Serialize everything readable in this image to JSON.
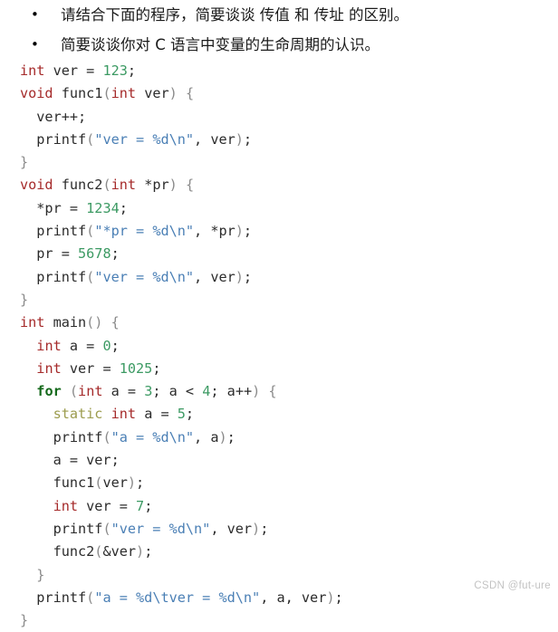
{
  "questions": [
    {
      "bullet": "•",
      "text": "请结合下面的程序，简要谈谈 传值 和 传址 的区别。"
    },
    {
      "bullet": "•",
      "text": "简要谈谈你对 C 语言中变量的生命周期的认识。"
    }
  ],
  "code": {
    "language": "c",
    "lines": [
      [
        {
          "t": "int",
          "c": "kw"
        },
        {
          "t": " ver ",
          "c": "plain"
        },
        {
          "t": "= ",
          "c": "plain"
        },
        {
          "t": "123",
          "c": "num"
        },
        {
          "t": ";",
          "c": "plain"
        }
      ],
      [
        {
          "t": "void",
          "c": "kw"
        },
        {
          "t": " func1",
          "c": "plain"
        },
        {
          "t": "(",
          "c": "punc"
        },
        {
          "t": "int",
          "c": "kw"
        },
        {
          "t": " ver",
          "c": "plain"
        },
        {
          "t": ")",
          "c": "punc"
        },
        {
          "t": " ",
          "c": "plain"
        },
        {
          "t": "{",
          "c": "punc"
        }
      ],
      [
        {
          "t": "  ver++;",
          "c": "plain"
        }
      ],
      [
        {
          "t": "  printf",
          "c": "plain"
        },
        {
          "t": "(",
          "c": "punc"
        },
        {
          "t": "\"ver = %d\\n\"",
          "c": "str"
        },
        {
          "t": ", ver",
          "c": "plain"
        },
        {
          "t": ")",
          "c": "punc"
        },
        {
          "t": ";",
          "c": "plain"
        }
      ],
      [
        {
          "t": "}",
          "c": "punc"
        }
      ],
      [
        {
          "t": "void",
          "c": "kw"
        },
        {
          "t": " func2",
          "c": "plain"
        },
        {
          "t": "(",
          "c": "punc"
        },
        {
          "t": "int",
          "c": "kw"
        },
        {
          "t": " *pr",
          "c": "plain"
        },
        {
          "t": ")",
          "c": "punc"
        },
        {
          "t": " ",
          "c": "plain"
        },
        {
          "t": "{",
          "c": "punc"
        }
      ],
      [
        {
          "t": "  *pr = ",
          "c": "plain"
        },
        {
          "t": "1234",
          "c": "num"
        },
        {
          "t": ";",
          "c": "plain"
        }
      ],
      [
        {
          "t": "  printf",
          "c": "plain"
        },
        {
          "t": "(",
          "c": "punc"
        },
        {
          "t": "\"*pr = %d\\n\"",
          "c": "str"
        },
        {
          "t": ", *pr",
          "c": "plain"
        },
        {
          "t": ")",
          "c": "punc"
        },
        {
          "t": ";",
          "c": "plain"
        }
      ],
      [
        {
          "t": "  pr = ",
          "c": "plain"
        },
        {
          "t": "5678",
          "c": "num"
        },
        {
          "t": ";",
          "c": "plain"
        }
      ],
      [
        {
          "t": "  printf",
          "c": "plain"
        },
        {
          "t": "(",
          "c": "punc"
        },
        {
          "t": "\"ver = %d\\n\"",
          "c": "str"
        },
        {
          "t": ", ver",
          "c": "plain"
        },
        {
          "t": ")",
          "c": "punc"
        },
        {
          "t": ";",
          "c": "plain"
        }
      ],
      [
        {
          "t": "}",
          "c": "punc"
        }
      ],
      [
        {
          "t": "int",
          "c": "kw"
        },
        {
          "t": " main",
          "c": "plain"
        },
        {
          "t": "()",
          "c": "punc"
        },
        {
          "t": " ",
          "c": "plain"
        },
        {
          "t": "{",
          "c": "punc"
        }
      ],
      [
        {
          "t": "  ",
          "c": "plain"
        },
        {
          "t": "int",
          "c": "kw"
        },
        {
          "t": " a = ",
          "c": "plain"
        },
        {
          "t": "0",
          "c": "num"
        },
        {
          "t": ";",
          "c": "plain"
        }
      ],
      [
        {
          "t": "  ",
          "c": "plain"
        },
        {
          "t": "int",
          "c": "kw"
        },
        {
          "t": " ver = ",
          "c": "plain"
        },
        {
          "t": "1025",
          "c": "num"
        },
        {
          "t": ";",
          "c": "plain"
        }
      ],
      [
        {
          "t": "  ",
          "c": "plain"
        },
        {
          "t": "for",
          "c": "kw-ctrl"
        },
        {
          "t": " ",
          "c": "plain"
        },
        {
          "t": "(",
          "c": "punc"
        },
        {
          "t": "int",
          "c": "kw"
        },
        {
          "t": " a = ",
          "c": "plain"
        },
        {
          "t": "3",
          "c": "num"
        },
        {
          "t": "; a < ",
          "c": "plain"
        },
        {
          "t": "4",
          "c": "num"
        },
        {
          "t": "; a++",
          "c": "plain"
        },
        {
          "t": ")",
          "c": "punc"
        },
        {
          "t": " ",
          "c": "plain"
        },
        {
          "t": "{",
          "c": "punc"
        }
      ],
      [
        {
          "t": "    ",
          "c": "plain"
        },
        {
          "t": "static",
          "c": "kw-stor"
        },
        {
          "t": " ",
          "c": "plain"
        },
        {
          "t": "int",
          "c": "kw"
        },
        {
          "t": " a = ",
          "c": "plain"
        },
        {
          "t": "5",
          "c": "num"
        },
        {
          "t": ";",
          "c": "plain"
        }
      ],
      [
        {
          "t": "    printf",
          "c": "plain"
        },
        {
          "t": "(",
          "c": "punc"
        },
        {
          "t": "\"a = %d\\n\"",
          "c": "str"
        },
        {
          "t": ", a",
          "c": "plain"
        },
        {
          "t": ")",
          "c": "punc"
        },
        {
          "t": ";",
          "c": "plain"
        }
      ],
      [
        {
          "t": "    a = ver;",
          "c": "plain"
        }
      ],
      [
        {
          "t": "    func1",
          "c": "plain"
        },
        {
          "t": "(",
          "c": "punc"
        },
        {
          "t": "ver",
          "c": "plain"
        },
        {
          "t": ")",
          "c": "punc"
        },
        {
          "t": ";",
          "c": "plain"
        }
      ],
      [
        {
          "t": "    ",
          "c": "plain"
        },
        {
          "t": "int",
          "c": "kw"
        },
        {
          "t": " ver = ",
          "c": "plain"
        },
        {
          "t": "7",
          "c": "num"
        },
        {
          "t": ";",
          "c": "plain"
        }
      ],
      [
        {
          "t": "    printf",
          "c": "plain"
        },
        {
          "t": "(",
          "c": "punc"
        },
        {
          "t": "\"ver = %d\\n\"",
          "c": "str"
        },
        {
          "t": ", ver",
          "c": "plain"
        },
        {
          "t": ")",
          "c": "punc"
        },
        {
          "t": ";",
          "c": "plain"
        }
      ],
      [
        {
          "t": "    func2",
          "c": "plain"
        },
        {
          "t": "(",
          "c": "punc"
        },
        {
          "t": "&ver",
          "c": "plain"
        },
        {
          "t": ")",
          "c": "punc"
        },
        {
          "t": ";",
          "c": "plain"
        }
      ],
      [
        {
          "t": "  ",
          "c": "plain"
        },
        {
          "t": "}",
          "c": "punc"
        }
      ],
      [
        {
          "t": "  printf",
          "c": "plain"
        },
        {
          "t": "(",
          "c": "punc"
        },
        {
          "t": "\"a = %d\\tver = %d\\n\"",
          "c": "str"
        },
        {
          "t": ", a, ver",
          "c": "plain"
        },
        {
          "t": ")",
          "c": "punc"
        },
        {
          "t": ";",
          "c": "plain"
        }
      ],
      [
        {
          "t": "}",
          "c": "punc"
        }
      ]
    ]
  },
  "watermark": {
    "text": "CSDN @fut-ure"
  },
  "colors": {
    "background": "#ffffff",
    "text": "#1a1a1a",
    "code_default": "#2b2b2b",
    "keyword": "#a52a2a",
    "keyword_control": "#14691b",
    "keyword_storage": "#9c9c4e",
    "number": "#3c9a63",
    "string": "#4a7fb5",
    "punctuation": "#8a8a8a",
    "watermark": "#c3c3c3"
  }
}
